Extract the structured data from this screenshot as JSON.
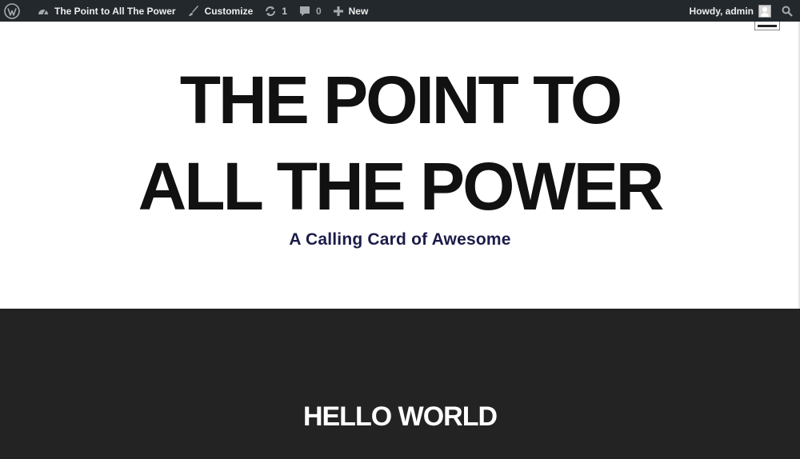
{
  "adminbar": {
    "wp_logo_icon": "wordpress-logo-icon",
    "site_name": "The Point to All The Power",
    "site_icon": "dashboard-icon",
    "customize": "Customize",
    "customize_icon": "brush-icon",
    "updates_count": "1",
    "updates_icon": "refresh-icon",
    "comments_count": "0",
    "comments_icon": "comment-icon",
    "new_label": "New",
    "new_icon": "plus-icon",
    "greeting": "Howdy, admin",
    "search_icon": "search-icon",
    "background_color": "#23282d"
  },
  "header": {
    "title_line1": "THE POINT TO",
    "title_line2": "ALL THE POWER",
    "description": "A Calling Card of Awesome",
    "menu_icon": "menu-toggle-icon"
  },
  "content": {
    "post_title": "HELLO WORLD",
    "background_color": "#232323"
  }
}
